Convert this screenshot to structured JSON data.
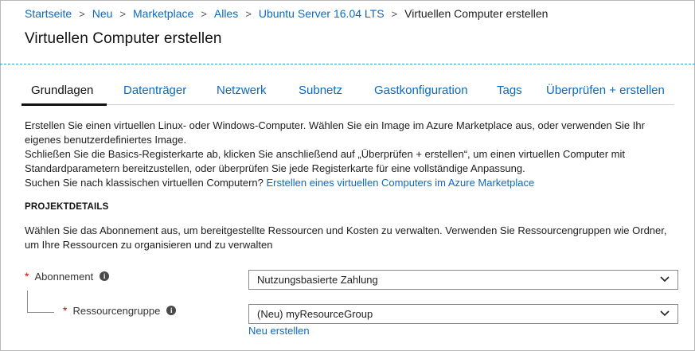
{
  "breadcrumb": {
    "items": [
      "Startseite",
      "Neu",
      "Marketplace",
      "Alles",
      "Ubuntu Server 16.04 LTS"
    ],
    "current": "Virtuellen Computer erstellen",
    "separator": ">"
  },
  "header": {
    "title": "Virtuellen Computer erstellen"
  },
  "tabs": [
    {
      "label": "Grundlagen",
      "active": true
    },
    {
      "label": "Datenträger"
    },
    {
      "label": "Netzwerk"
    },
    {
      "label": "Subnetz"
    },
    {
      "label": "Gastkonfiguration"
    },
    {
      "label": "Tags"
    },
    {
      "label": "Überprüfen + erstellen"
    }
  ],
  "intro": {
    "line1": "Erstellen Sie einen virtuellen Linux- oder Windows-Computer. Wählen Sie ein Image im Azure Marketplace aus, oder verwenden Sie Ihr eigenes benutzerdefiniertes Image.",
    "line2": "Schließen Sie die Basics-Registerkarte ab, klicken Sie anschließend auf „Überprüfen + erstellen“, um einen virtuellen Computer mit Standardparametern bereitzustellen, oder überprüfen Sie jede Registerkarte für eine vollständige Anpassung.",
    "line3_text": "Suchen Sie nach klassischen virtuellen Computern?",
    "line3_link": "Erstellen eines virtuellen Computers im Azure Marketplace"
  },
  "project_details": {
    "heading": "PROJEKTDETAILS",
    "description": "Wählen Sie das Abonnement aus, um bereitgestellte Ressourcen und Kosten zu verwalten. Verwenden Sie Ressourcengruppen wie Ordner, um Ihre Ressourcen zu organisieren und zu verwalten",
    "subscription": {
      "required_mark": "*",
      "label": "Abonnement",
      "info": "i",
      "value": "Nutzungsbasierte Zahlung"
    },
    "resource_group": {
      "required_mark": "*",
      "label": "Ressourcengruppe",
      "info": "i",
      "value": "(Neu) myResourceGroup",
      "create_new": "Neu erstellen"
    }
  },
  "colors": {
    "link": "#0b6ac0",
    "required": "#d00000",
    "header_border": "#2aa3d6"
  },
  "icons": {
    "dropdown": "chevron-down-icon",
    "info": "info-icon",
    "separator": "chevron-right-icon"
  }
}
